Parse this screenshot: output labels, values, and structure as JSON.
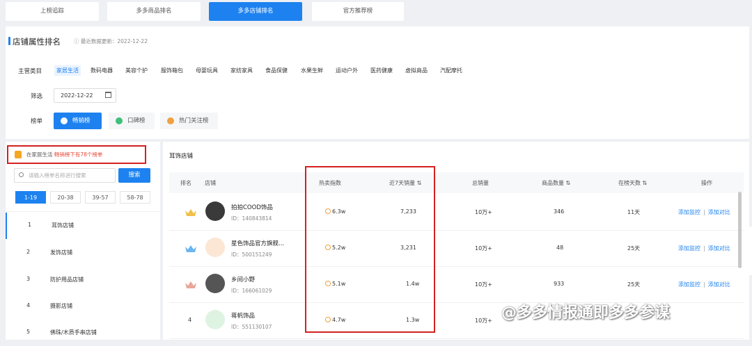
{
  "tabs": [
    {
      "label": "上榜追踪",
      "active": false
    },
    {
      "label": "多多商品排名",
      "active": false
    },
    {
      "label": "多多店铺排名",
      "active": true
    },
    {
      "label": "官方推荐榜",
      "active": false
    }
  ],
  "header": {
    "title": "店铺属性排名",
    "update_time": "ⓘ 最近数据更新：2022-12-22"
  },
  "filters": {
    "category_label": "主营类目",
    "categories": [
      "家居生活",
      "数码电器",
      "美容个护",
      "服饰箱包",
      "母婴玩具",
      "家纺家具",
      "食品保健",
      "水果生鲜",
      "运动户外",
      "医药健康",
      "虚拟商品",
      "汽配摩托"
    ],
    "date_label": "筛选",
    "date_value": "2022-12-22",
    "board_label": "榜单",
    "boards": [
      {
        "label": "畅销榜",
        "active": true
      },
      {
        "label": "口碑榜",
        "active": false
      },
      {
        "label": "热门关注榜",
        "active": false
      }
    ]
  },
  "sidebar": {
    "hint_prefix": "在家居生活",
    "hint_highlight": "畅销榜下有78个榜单",
    "search_placeholder": "请输入榜单名称进行搜索",
    "search_button": "搜索",
    "ranges": [
      {
        "label": "1-19",
        "active": true
      },
      {
        "label": "20-38",
        "active": false
      },
      {
        "label": "39-57",
        "active": false
      },
      {
        "label": "58-78",
        "active": false
      }
    ],
    "items": [
      {
        "num": "1",
        "label": "耳饰店铺",
        "active": true
      },
      {
        "num": "2",
        "label": "发饰店铺",
        "active": false
      },
      {
        "num": "3",
        "label": "防护用品店铺",
        "active": false
      },
      {
        "num": "4",
        "label": "摄影店铺",
        "active": false
      },
      {
        "num": "5",
        "label": "佛珠/木质手串店铺",
        "active": false
      }
    ]
  },
  "table": {
    "title": "耳饰店铺",
    "columns": [
      "排名",
      "店铺",
      "热卖指数",
      "近7天销量 ⇅",
      "总销量",
      "商品数量 ⇅",
      "在榜天数 ⇅",
      "操作"
    ],
    "rows": [
      {
        "rank": "",
        "crown": "gold",
        "name": "拍拍COOD饰品",
        "id": "ID：140843814",
        "hot": "6.3w",
        "sales7": "7,233",
        "total": "10万+",
        "products": "346",
        "days": "11天"
      },
      {
        "rank": "",
        "crown": "blue",
        "name": "星色饰品官方旗舰...",
        "id": "ID：500151249",
        "hot": "5.2w",
        "sales7": "3,231",
        "total": "10万+",
        "products": "48",
        "days": "25天"
      },
      {
        "rank": "",
        "crown": "bronze",
        "name": "乡间小野",
        "id": "ID：166061029",
        "hot": "5.1w",
        "sales7": "1.4w",
        "total": "10万+",
        "products": "933",
        "days": "25天"
      },
      {
        "rank": "4",
        "crown": "",
        "name": "蒋帆饰品",
        "id": "ID：551130107",
        "hot": "4.7w",
        "sales7": "1.3w",
        "total": "10万+",
        "products": "",
        "days": ""
      }
    ],
    "op_monitor": "添加监控",
    "op_compare": "添加对比"
  },
  "watermark": "@多多情报通即多多参谋",
  "colors": {
    "accent": "#1d82f0",
    "highlight_red": "#d32020",
    "hint_red": "#e94a3a"
  }
}
